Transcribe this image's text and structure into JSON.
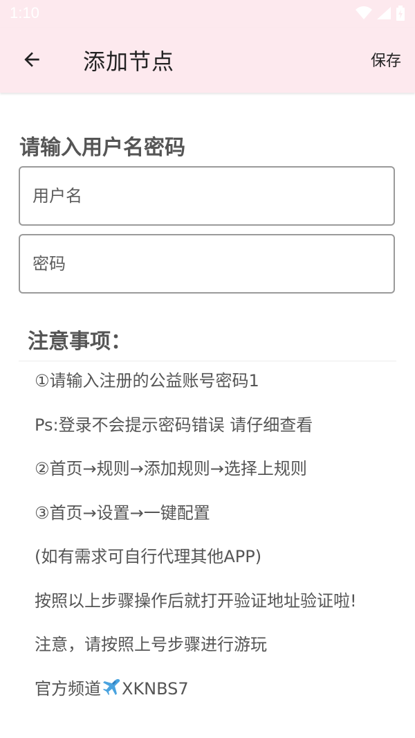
{
  "status_bar": {
    "time": "1:10"
  },
  "app_bar": {
    "title": "添加节点",
    "save_label": "保存"
  },
  "form": {
    "heading": "请输入用户名密码",
    "username_placeholder": "用户名",
    "password_placeholder": "密码"
  },
  "notice": {
    "title": "注意事项：",
    "lines": [
      "①请输入注册的公益账号密码1",
      "Ps:登录不会提示密码错误 请仔细查看",
      "②首页→规则→添加规则→选择上规则",
      "③首页→设置→一键配置",
      "(如有需求可自行代理其他APP)",
      "按照以上步骤操作后就打开验证地址验证啦!",
      "注意，请按照上号步骤进行游玩"
    ],
    "channel_prefix": "官方频道",
    "channel_id": "XKNBS7",
    "channel_icon": "airplane-icon"
  },
  "colors": {
    "app_bar_bg": "#fde9ee",
    "text_primary": "#222222",
    "text_secondary": "#555555",
    "field_border": "#9a9a9a"
  }
}
